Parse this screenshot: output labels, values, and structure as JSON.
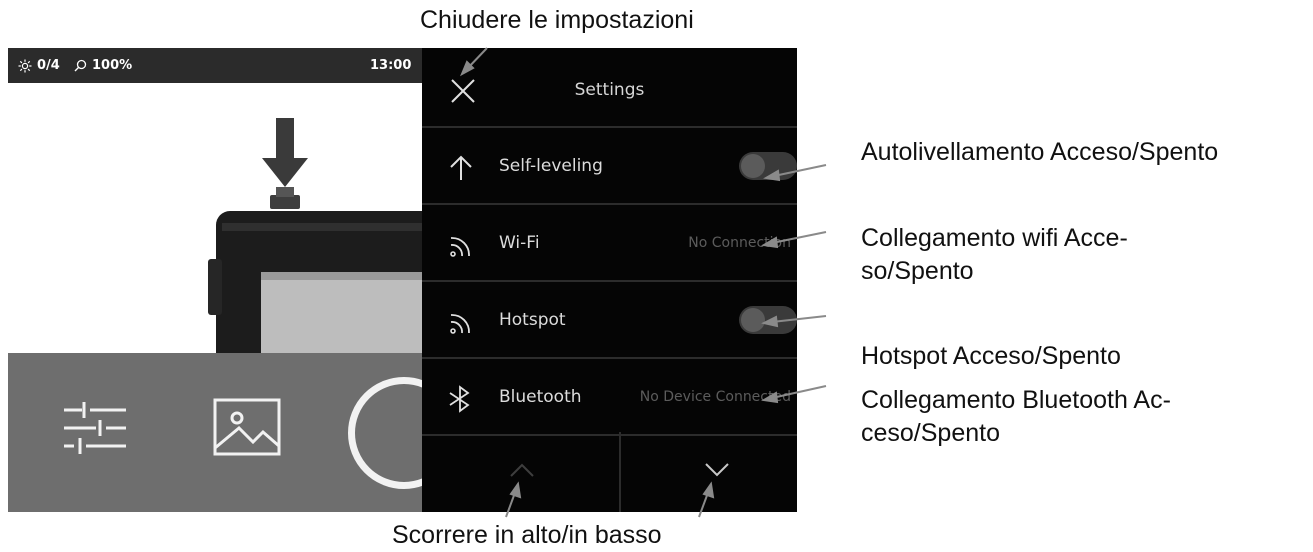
{
  "status_bar": {
    "brightness": "0/4",
    "zoom": "100%",
    "time": "13:00",
    "icons": {
      "brightness": "sun-icon",
      "zoom": "magnifier-icon"
    }
  },
  "bottom_bar": {
    "icons": {
      "adjust": "sliders-icon",
      "gallery": "image-icon",
      "shutter": "shutter-button"
    }
  },
  "settings": {
    "title": "Settings",
    "close_icon": "close-icon",
    "rows": [
      {
        "label": "Self-leveling",
        "icon": "arrow-up-icon",
        "control": "toggle",
        "state": "off"
      },
      {
        "label": "Wi-Fi",
        "icon": "wifi-icon",
        "value": "No Connection"
      },
      {
        "label": "Hotspot",
        "icon": "wifi-icon",
        "control": "toggle",
        "state": "off"
      },
      {
        "label": "Bluetooth",
        "icon": "bluetooth-icon",
        "value": "No Device Connected"
      }
    ],
    "nav": {
      "up_icon": "chevron-up-icon",
      "down_icon": "chevron-down-icon"
    }
  },
  "annotations": {
    "close": "Chiudere le impostazioni",
    "self_leveling": "Autolivellamento Acceso/Spento",
    "wifi_line1": "Collegamento wifi Acce-",
    "wifi_line2": "so/Spento",
    "hotspot": "Hotspot Acceso/Spento",
    "bluetooth_line1": "Collegamento Bluetooth Ac-",
    "bluetooth_line2": "ceso/Spento",
    "scroll": "Scorrere in alto/in basso"
  },
  "colors": {
    "panel_bg": "#050505",
    "status_bar_bg": "#2b2b2b",
    "bottom_bar_bg": "#6e6e6e",
    "divider": "#2c2c2c",
    "arrow": "#888888"
  }
}
